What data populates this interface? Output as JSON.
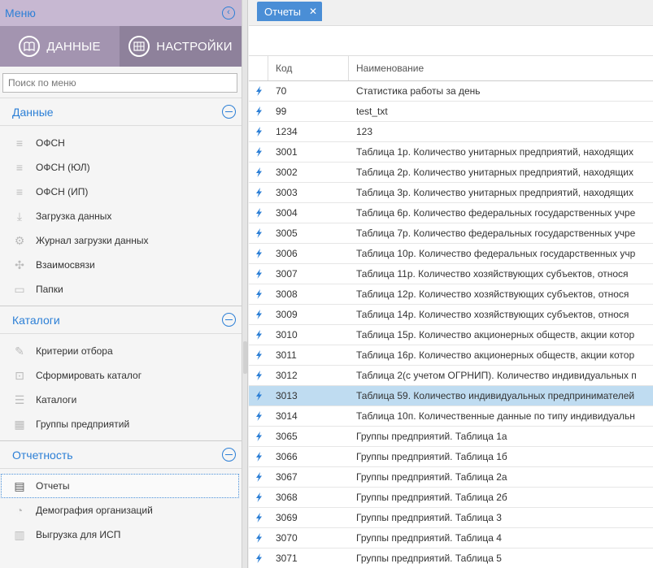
{
  "menu": {
    "title": "Меню"
  },
  "top_tabs": {
    "data": "ДАННЫЕ",
    "settings": "НАСТРОЙКИ"
  },
  "search": {
    "placeholder": "Поиск по меню"
  },
  "sections": {
    "data": {
      "label": "Данные",
      "items": [
        "ОФСН",
        "ОФСН (ЮЛ)",
        "ОФСН (ИП)",
        "Загрузка данных",
        "Журнал загрузки данных",
        "Взаимосвязи",
        "Папки"
      ]
    },
    "catalogs": {
      "label": "Каталоги",
      "items": [
        "Критерии отбора",
        "Сформировать каталог",
        "Каталоги",
        "Группы предприятий"
      ]
    },
    "reports": {
      "label": "Отчетность",
      "items": [
        "Отчеты",
        "Демография организаций",
        "Выгрузка для ИСП"
      ]
    }
  },
  "tab": {
    "label": "Отчеты",
    "close": "✕"
  },
  "grid": {
    "columns": {
      "code": "Код",
      "name": "Наименование"
    },
    "rows": [
      {
        "code": "70",
        "name": "Статистика работы за день"
      },
      {
        "code": "99",
        "name": "test_txt"
      },
      {
        "code": "1234",
        "name": "123"
      },
      {
        "code": "3001",
        "name": "Таблица 1р. Количество унитарных предприятий, находящих"
      },
      {
        "code": "3002",
        "name": "Таблица 2р. Количество унитарных предприятий, находящих"
      },
      {
        "code": "3003",
        "name": "Таблица 3р. Количество унитарных предприятий, находящих"
      },
      {
        "code": "3004",
        "name": "Таблица 6р. Количество федеральных государственных учре"
      },
      {
        "code": "3005",
        "name": "Таблица 7р. Количество федеральных государственных учре"
      },
      {
        "code": "3006",
        "name": "Таблица 10р. Количество федеральных государственных учр"
      },
      {
        "code": "3007",
        "name": "Таблица 11р. Количество хозяйствующих субъектов, относя"
      },
      {
        "code": "3008",
        "name": "Таблица 12р. Количество хозяйствующих субъектов, относя"
      },
      {
        "code": "3009",
        "name": "Таблица 14р. Количество хозяйствующих субъектов, относя"
      },
      {
        "code": "3010",
        "name": "Таблица 15р. Количество акционерных обществ, акции котор"
      },
      {
        "code": "3011",
        "name": "Таблица 16р. Количество акционерных обществ, акции котор"
      },
      {
        "code": "3012",
        "name": "Таблица 2(с учетом ОГРНИП). Количество индивидуальных п"
      },
      {
        "code": "3013",
        "name": "Таблица 59. Количество индивидуальных предпринимателей"
      },
      {
        "code": "3014",
        "name": "Таблица 10п. Количественные данные по типу индивидуальн"
      },
      {
        "code": "3065",
        "name": "Группы предприятий. Таблица 1а"
      },
      {
        "code": "3066",
        "name": "Группы предприятий. Таблица 1б"
      },
      {
        "code": "3067",
        "name": "Группы предприятий. Таблица 2а"
      },
      {
        "code": "3068",
        "name": "Группы предприятий. Таблица 2б"
      },
      {
        "code": "3069",
        "name": "Группы предприятий. Таблица 3"
      },
      {
        "code": "3070",
        "name": "Группы предприятий. Таблица 4"
      },
      {
        "code": "3071",
        "name": "Группы предприятий. Таблица 5"
      }
    ],
    "selected_code": "3013"
  },
  "colors": {
    "accent": "#2c7fd6",
    "tab": "#4a8ed6",
    "row_selected": "#bfdcf1",
    "menu_header": "#c7b8d2"
  }
}
